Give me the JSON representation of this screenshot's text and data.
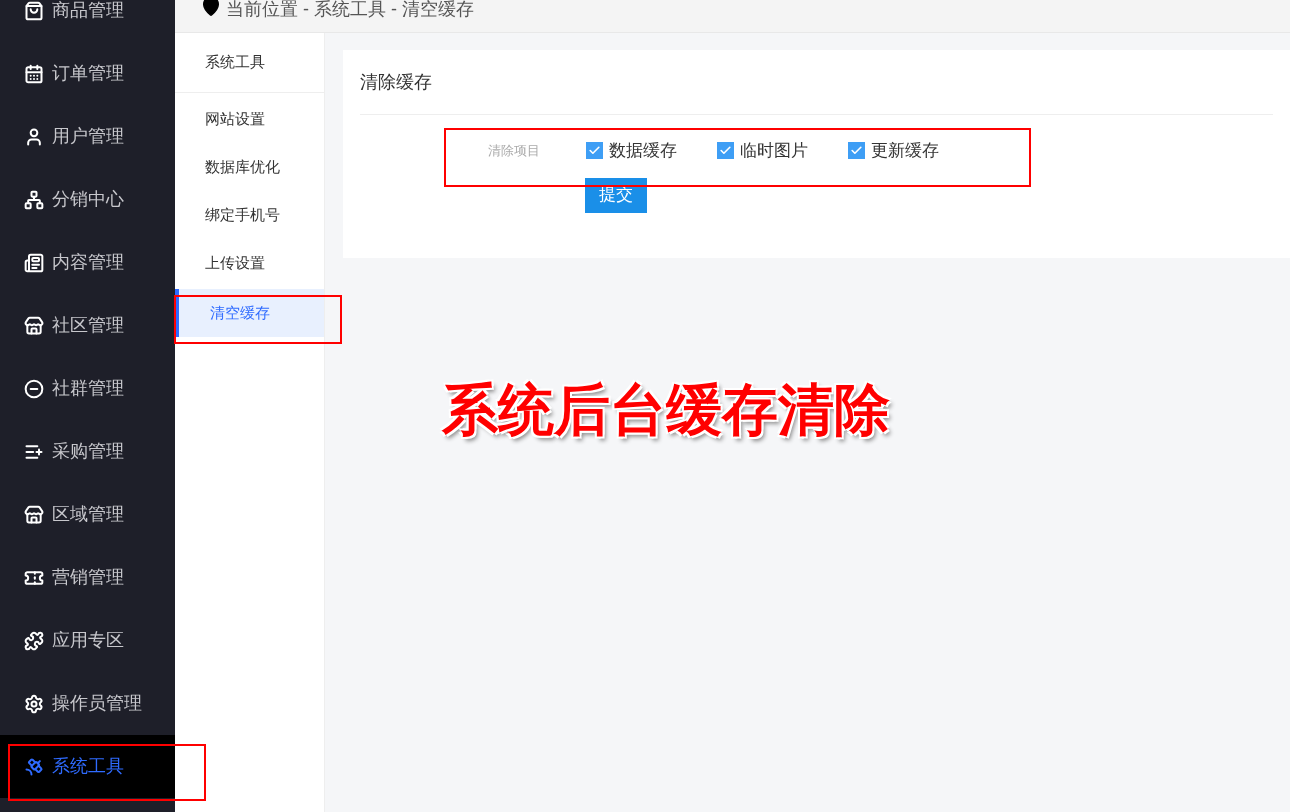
{
  "sidebar": {
    "items": [
      {
        "label": "商品管理",
        "selected": false
      },
      {
        "label": "订单管理",
        "selected": false
      },
      {
        "label": "用户管理",
        "selected": false
      },
      {
        "label": "分销中心",
        "selected": false
      },
      {
        "label": "内容管理",
        "selected": false
      },
      {
        "label": "社区管理",
        "selected": false
      },
      {
        "label": "社群管理",
        "selected": false
      },
      {
        "label": "采购管理",
        "selected": false
      },
      {
        "label": "区域管理",
        "selected": false
      },
      {
        "label": "营销管理",
        "selected": false
      },
      {
        "label": "应用专区",
        "selected": false
      },
      {
        "label": "操作员管理",
        "selected": false
      },
      {
        "label": "系统工具",
        "selected": true
      }
    ]
  },
  "breadcrumb": "当前位置 - 系统工具 - 清空缓存",
  "submenu": {
    "title": "系统工具",
    "items": [
      {
        "label": "网站设置",
        "selected": false
      },
      {
        "label": "数据库优化",
        "selected": false
      },
      {
        "label": "绑定手机号",
        "selected": false
      },
      {
        "label": "上传设置",
        "selected": false
      },
      {
        "label": "清空缓存",
        "selected": true
      }
    ]
  },
  "card": {
    "title": "清除缓存",
    "field_label": "清除项目",
    "options": [
      {
        "label": "数据缓存",
        "checked": true
      },
      {
        "label": "临时图片",
        "checked": true
      },
      {
        "label": "更新缓存",
        "checked": true
      }
    ],
    "submit": "提交"
  },
  "annotation": "系统后台缓存清除"
}
